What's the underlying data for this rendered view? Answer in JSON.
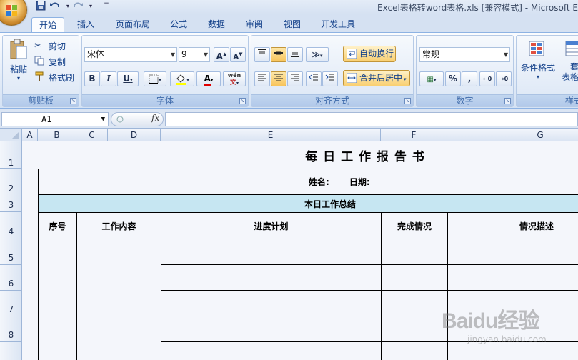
{
  "window": {
    "title": "Excel表格转word表格.xls  [兼容模式] - Microsoft E"
  },
  "quick_access": {
    "save_icon": "save-icon",
    "undo_icon": "undo-icon",
    "redo_icon": "redo-icon"
  },
  "tabs": [
    "开始",
    "插入",
    "页面布局",
    "公式",
    "数据",
    "审阅",
    "视图",
    "开发工具"
  ],
  "active_tab": "开始",
  "clipboard": {
    "paste": "粘贴",
    "cut": "剪切",
    "copy": "复制",
    "format_painter": "格式刷",
    "label": "剪贴板"
  },
  "font": {
    "name": "宋体",
    "size": "9",
    "bold": "B",
    "italic": "I",
    "underline": "U",
    "grow": "A",
    "shrink": "A",
    "color_letter": "A",
    "phonetic": "wén",
    "label": "字体"
  },
  "alignment": {
    "wrap": "自动换行",
    "merge": "合并后居中",
    "label": "对齐方式"
  },
  "number": {
    "format": "常规",
    "percent": "%",
    "comma": ",",
    "label": "数字"
  },
  "styles": {
    "conditional": "条件格式",
    "table_part": "套",
    "table_part2": "表格格",
    "label": "样式"
  },
  "formula_bar": {
    "name_box": "A1",
    "fx": "fx",
    "value": ""
  },
  "columns": [
    "A",
    "B",
    "C",
    "D",
    "E",
    "F",
    "G"
  ],
  "rows": [
    "1",
    "2",
    "3",
    "4",
    "5",
    "6",
    "7",
    "8"
  ],
  "sheet": {
    "title": "每 日 工 作 报 告 书",
    "name_label": "姓名:",
    "date_label": "日期:",
    "summary": "本日工作总结",
    "headers": [
      "序号",
      "工作内容",
      "进度计划",
      "完成情况",
      "情况描述"
    ]
  },
  "watermark": {
    "brand": "Baidu经验",
    "url": "jingyan.baidu.com"
  },
  "colors": {
    "summary_bg": "#c6e6f2",
    "ribbon_accent": "#15428b",
    "highlight": "#f9cf71"
  }
}
